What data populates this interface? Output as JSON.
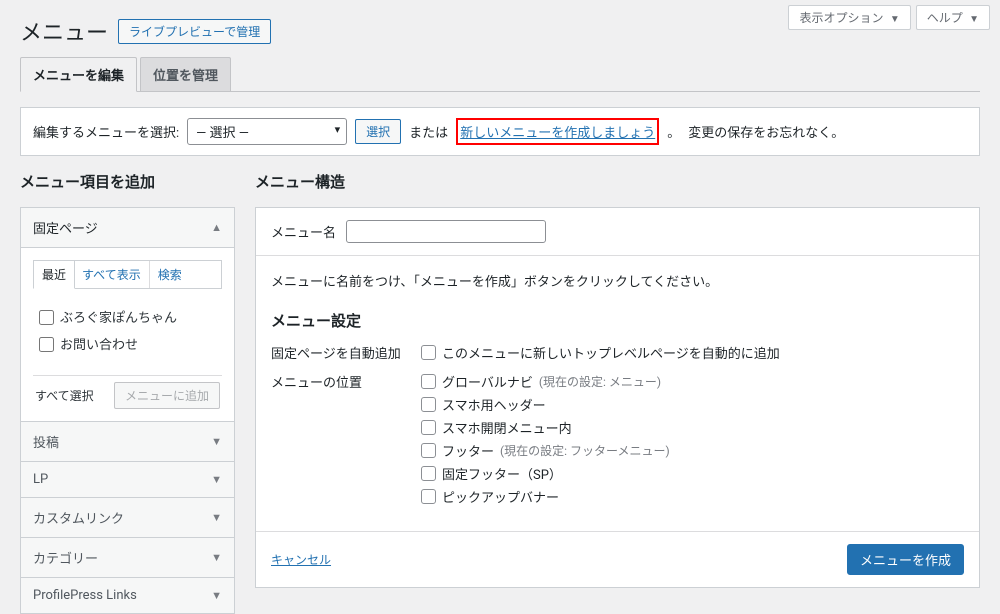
{
  "topbar": {
    "options_label": "表示オプション",
    "help_label": "ヘルプ"
  },
  "header": {
    "title": "メニュー",
    "live_preview_btn": "ライブプレビューで管理"
  },
  "tabs": {
    "edit": "メニューを編集",
    "manage": "位置を管理"
  },
  "selectbar": {
    "label": "編集するメニューを選択:",
    "default_option": "— 選択 —",
    "select_btn": "選択",
    "or_text": "または",
    "create_link": "新しいメニューを作成しましょう",
    "period": "。",
    "save_hint": "変更の保存をお忘れなく。"
  },
  "sidebar": {
    "heading": "メニュー項目を追加",
    "panels": {
      "pages": "固定ページ",
      "posts": "投稿",
      "lp": "LP",
      "custom": "カスタムリンク",
      "category": "カテゴリー",
      "pplinks": "ProfilePress Links"
    },
    "pages_tabs": {
      "recent": "最近",
      "all": "すべて表示",
      "search": "検索"
    },
    "page_items": [
      "ぶろぐ家ぽんちゃん",
      "お問い合わせ"
    ],
    "select_all": "すべて選択",
    "add_btn": "メニューに追加"
  },
  "main": {
    "heading": "メニュー構造",
    "name_label": "メニュー名",
    "name_value": "",
    "create_hint": "メニューに名前をつけ、「メニューを作成」ボタンをクリックしてください。",
    "settings_heading": "メニュー設定",
    "auto_add_label": "固定ページを自動追加",
    "auto_add_text": "このメニューに新しいトップレベルページを自動的に追加",
    "location_label": "メニューの位置",
    "locations": [
      {
        "name": "グローバルナビ",
        "hint": "(現在の設定: メニュー)"
      },
      {
        "name": "スマホ用ヘッダー",
        "hint": ""
      },
      {
        "name": "スマホ開閉メニュー内",
        "hint": ""
      },
      {
        "name": "フッター",
        "hint": "(現在の設定: フッターメニュー)"
      },
      {
        "name": "固定フッター（SP）",
        "hint": ""
      },
      {
        "name": "ピックアップバナー",
        "hint": ""
      }
    ],
    "cancel": "キャンセル",
    "create_btn": "メニューを作成"
  }
}
